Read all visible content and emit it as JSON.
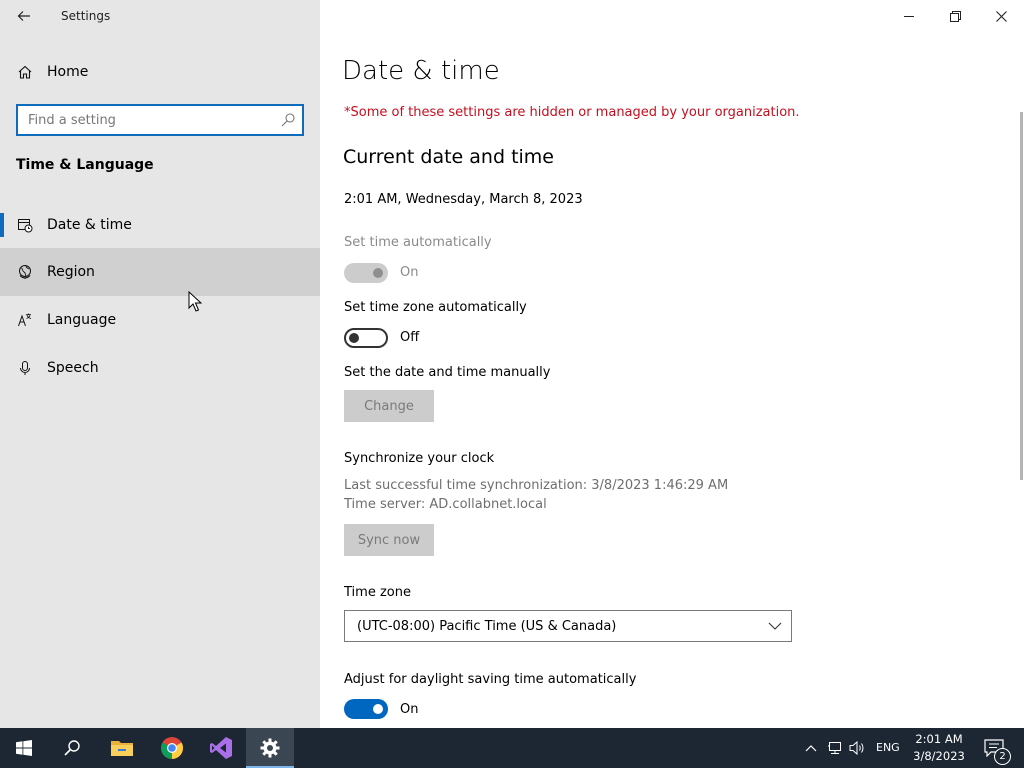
{
  "window": {
    "title": "Settings",
    "minimize_glyph": "minimize-icon",
    "maximize_glyph": "restore-icon",
    "close_glyph": "close-icon"
  },
  "sidebar": {
    "home_label": "Home",
    "search_placeholder": "Find a setting",
    "section_title": "Time & Language",
    "items": [
      {
        "label": "Date & time",
        "icon": "date-time-icon",
        "selected": true
      },
      {
        "label": "Region",
        "icon": "region-icon",
        "hovered": true
      },
      {
        "label": "Language",
        "icon": "language-icon"
      },
      {
        "label": "Speech",
        "icon": "microphone-icon"
      }
    ]
  },
  "main": {
    "title": "Date & time",
    "org_warning": "*Some of these settings are hidden or managed by your organization.",
    "current_header": "Current date and time",
    "current_datetime": "2:01 AM, Wednesday, March 8, 2023",
    "set_time_auto": {
      "label": "Set time automatically",
      "state": "On",
      "enabled": false
    },
    "set_timezone_auto": {
      "label": "Set time zone automatically",
      "state": "Off",
      "enabled": true
    },
    "manual": {
      "label": "Set the date and time manually",
      "button": "Change"
    },
    "sync": {
      "header": "Synchronize your clock",
      "last_sync": "Last successful time synchronization: 3/8/2023 1:46:29 AM",
      "server": "Time server: AD.collabnet.local",
      "button": "Sync now"
    },
    "timezone": {
      "label": "Time zone",
      "value": "(UTC-08:00) Pacific Time (US & Canada)"
    },
    "daylight": {
      "label": "Adjust for daylight saving time automatically",
      "state": "On",
      "enabled": true
    }
  },
  "colors": {
    "accent": "#0067c0",
    "warning": "#c50f1f",
    "sidebar_bg": "#e6e6e6",
    "taskbar_bg": "#1c2733"
  },
  "taskbar": {
    "apps": [
      "start-icon",
      "search-icon",
      "file-explorer-icon",
      "chrome-icon",
      "visual-studio-icon",
      "settings-icon"
    ],
    "language": "ENG",
    "time": "2:01 AM",
    "date": "3/8/2023",
    "notification_count": "2"
  }
}
